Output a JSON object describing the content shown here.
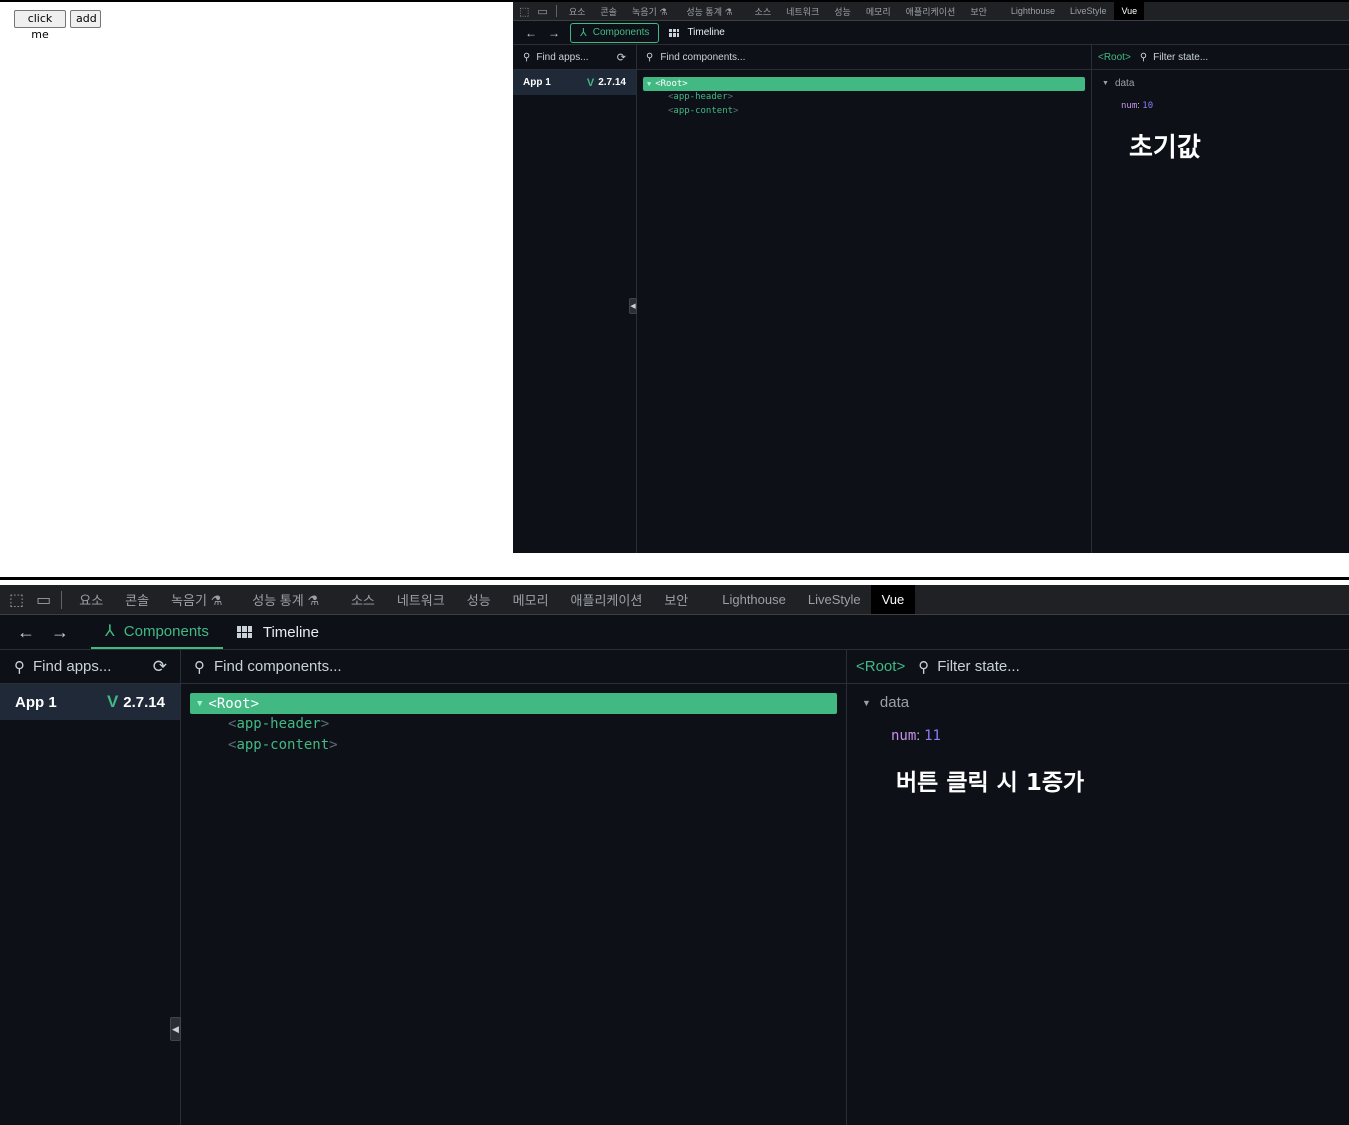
{
  "page": {
    "click_btn": "click me",
    "add_btn": "add"
  },
  "devtools": {
    "tabs": [
      "요소",
      "콘솔",
      "녹음기 ⚗",
      "성능 통계 ⚗",
      "소스",
      "네트워크",
      "성능",
      "메모리",
      "애플리케이션",
      "보안",
      "Lighthouse",
      "LiveStyle"
    ],
    "active_tab": "Vue",
    "components_label": "Components",
    "timeline_label": "Timeline",
    "find_apps_placeholder": "Find apps...",
    "find_components_placeholder": "Find components...",
    "filter_state_placeholder": "Filter state...",
    "root_crumb": "<Root>",
    "app_name": "App 1",
    "vue_version": "2.7.14",
    "tree": {
      "root": "<Root>",
      "children": [
        "app-header",
        "app-content"
      ]
    },
    "state_section": "data",
    "state_key": "num"
  },
  "snapshots": [
    {
      "num": "10",
      "caption": "초기값"
    },
    {
      "num": "11",
      "caption": "버튼 클릭 시 1증가"
    }
  ],
  "colors": {
    "vue_green": "#42b883",
    "panel_bg": "#0d1117",
    "tabbar_bg": "#202124"
  },
  "icons": [
    "inspect-icon",
    "device-icon",
    "back-arrow-icon",
    "forward-arrow-icon",
    "components-icon",
    "timeline-icon",
    "search-icon",
    "refresh-icon",
    "vue-logo-icon",
    "expand-triangle-icon",
    "collapse-handle-icon"
  ]
}
